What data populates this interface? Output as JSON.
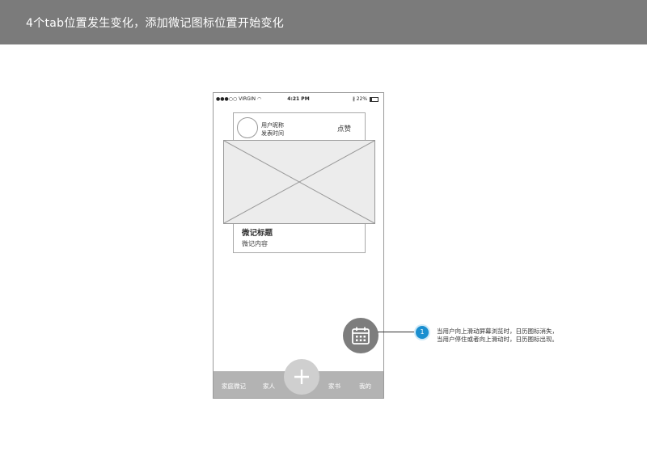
{
  "header": {
    "title": "4个tab位置发生变化，添加微记图标位置开始变化"
  },
  "status_bar": {
    "carrier": "●●●○○ VIRGIN",
    "time": "4:21 PM",
    "battery": "22%"
  },
  "post": {
    "user_name": "用户昵称",
    "post_time": "发表时间",
    "like": "点赞",
    "title": "微记标题",
    "content": "微记内容"
  },
  "fab": {
    "calendar_icon": "calendar-icon",
    "add_icon": "plus-icon"
  },
  "tabs": [
    {
      "label": "家庭微记"
    },
    {
      "label": "家人"
    },
    {
      "label": "家书"
    },
    {
      "label": "我的"
    }
  ],
  "annotation": {
    "number": "1",
    "line1": "当用户向上滑动屏幕浏览时，日历图标消失，",
    "line2": "当用户停住或者向上滑动时，日历图标出现。"
  },
  "colors": {
    "header_bg": "#7b7b7b",
    "tab_bar_bg": "#b3b3b3",
    "calendar_fab_bg": "#7d7d7d",
    "annotation_dot": "#1a8fd0"
  }
}
